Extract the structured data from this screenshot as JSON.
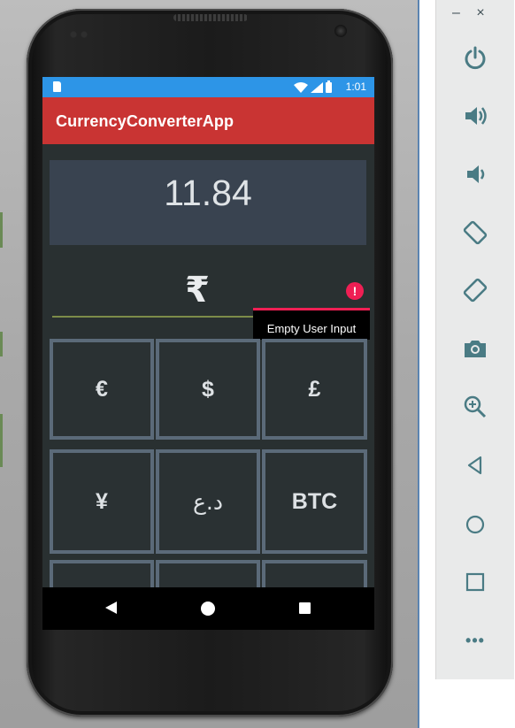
{
  "status_bar": {
    "time": "1:01"
  },
  "app_bar": {
    "title": "CurrencyConverterApp"
  },
  "converter": {
    "result_value": "11.84",
    "input_currency_symbol": "₹",
    "error_tooltip": "Empty User Input"
  },
  "keypad": {
    "keys": [
      "€",
      "$",
      "£",
      "¥",
      "د.ع",
      "BTC"
    ]
  },
  "emulator_panel": {
    "window_controls": {
      "minimize": "–",
      "close": "×"
    },
    "buttons": [
      "power",
      "volume-up",
      "volume-down",
      "rotate-left",
      "rotate-right",
      "screenshot",
      "zoom",
      "back",
      "home",
      "overview",
      "more"
    ],
    "more_label": "•••"
  },
  "colors": {
    "status_bar": "#2d95e7",
    "app_bar": "#c93433",
    "error_accent": "#ef1f54",
    "keypad_border": "#5b6a79",
    "emulator_icon": "#4a7b84"
  }
}
